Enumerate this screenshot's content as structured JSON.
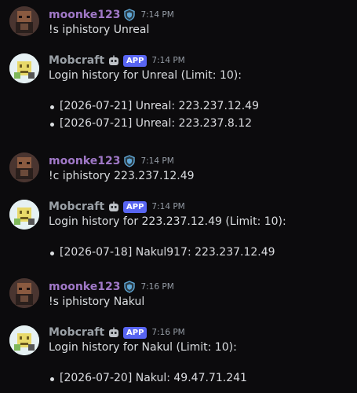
{
  "messages": [
    {
      "author": "moonke123",
      "type": "user",
      "time": "7:14 PM",
      "text": "!s iphistory Unreal"
    },
    {
      "author": "Mobcraft",
      "type": "bot",
      "app": "APP",
      "time": "7:14 PM",
      "text": "Login history for Unreal (Limit: 10):",
      "items": [
        "[2026-07-21] Unreal: 223.237.12.49",
        "[2026-07-21] Unreal: 223.237.8.12"
      ]
    },
    {
      "author": "moonke123",
      "type": "user",
      "time": "7:14 PM",
      "text": "!c iphistory 223.237.12.49"
    },
    {
      "author": "Mobcraft",
      "type": "bot",
      "app": "APP",
      "time": "7:14 PM",
      "text": "Login history for 223.237.12.49 (Limit: 10):",
      "items": [
        "[2026-07-18] Nakul917: 223.237.12.49"
      ]
    },
    {
      "author": "moonke123",
      "type": "user",
      "time": "7:16 PM",
      "text": "!s iphistory Nakul"
    },
    {
      "author": "Mobcraft",
      "type": "bot",
      "app": "APP",
      "time": "7:16 PM",
      "text": "Login history for Nakul (Limit: 10):",
      "items": [
        "[2026-07-20] Nakul: 49.47.71.241"
      ]
    }
  ],
  "colors": {
    "user_name": "#a078c7",
    "bot_name": "#9aa0a6",
    "app_tag": "#5865f2",
    "background": "#0c0b0d"
  },
  "icons": {
    "user_badge": "shield-icon",
    "bot_badge": "bot-icon"
  }
}
